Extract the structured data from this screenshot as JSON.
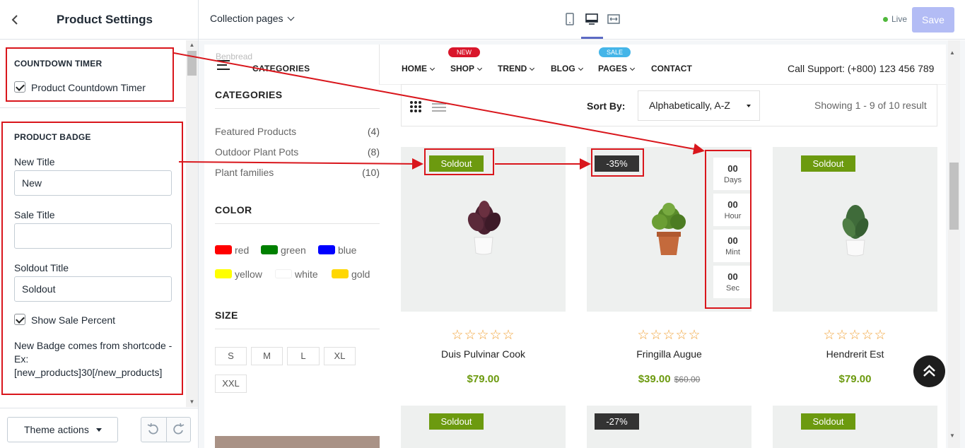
{
  "sidebar": {
    "title": "Product Settings",
    "countdown": {
      "heading": "COUNTDOWN TIMER",
      "checkbox_label": "Product Countdown Timer"
    },
    "badge": {
      "heading": "PRODUCT BADGE",
      "new_title_label": "New Title",
      "new_title_value": "New",
      "sale_title_label": "Sale Title",
      "sale_title_value": "",
      "soldout_title_label": "Soldout Title",
      "soldout_title_value": "Soldout",
      "show_sale_label": "Show Sale Percent",
      "help_text": "New Badge comes from shortcode - Ex: [new_products]30[/new_products]"
    },
    "footer": {
      "theme_actions": "Theme actions"
    }
  },
  "topbar": {
    "collection": "Collection pages",
    "live": "Live",
    "save": "Save"
  },
  "store": {
    "breadcrumb": "Benbread",
    "categories_menu": "CATEGORIES",
    "nav": [
      {
        "label": "HOME"
      },
      {
        "label": "SHOP"
      },
      {
        "label": "TREND"
      },
      {
        "label": "BLOG"
      },
      {
        "label": "PAGES"
      },
      {
        "label": "CONTACT"
      }
    ],
    "tags": {
      "new": "NEW",
      "sale": "SALE"
    },
    "support": "Call Support: (+800) 123 456 789",
    "filters": {
      "categories_title": "CATEGORIES",
      "categories": [
        {
          "name": "Featured Products",
          "count": "(4)"
        },
        {
          "name": "Outdoor Plant Pots",
          "count": "(8)"
        },
        {
          "name": "Plant families",
          "count": "(10)"
        }
      ],
      "color_title": "COLOR",
      "colors": [
        {
          "name": "red",
          "hex": "#ff0000"
        },
        {
          "name": "green",
          "hex": "#008000"
        },
        {
          "name": "blue",
          "hex": "#0000ff"
        },
        {
          "name": "yellow",
          "hex": "#ffff00"
        },
        {
          "name": "white",
          "hex": "#ffffff"
        },
        {
          "name": "gold",
          "hex": "#ffd700"
        }
      ],
      "size_title": "SIZE",
      "sizes": [
        "S",
        "M",
        "L",
        "XL",
        "XXL"
      ]
    },
    "toolbar": {
      "sort_by": "Sort By:",
      "sort_value": "Alphabetically, A-Z",
      "showing": "Showing 1 - 9 of 10 result"
    },
    "countdown": [
      {
        "num": "00",
        "label": "Days"
      },
      {
        "num": "00",
        "label": "Hour"
      },
      {
        "num": "00",
        "label": "Mint"
      },
      {
        "num": "00",
        "label": "Sec"
      }
    ],
    "products": [
      {
        "name": "Duis Pulvinar Cook",
        "price": "$79.00",
        "old_price": "",
        "badge": "Soldout",
        "rating": 0
      },
      {
        "name": "Fringilla Augue",
        "price": "$39.00",
        "old_price": "$60.00",
        "badge": "-35%",
        "rating": 0
      },
      {
        "name": "Hendrerit Est",
        "price": "$79.00",
        "old_price": "",
        "badge": "Soldout",
        "rating": 0
      }
    ],
    "row2_badges": [
      "Soldout",
      "-27%",
      "Soldout"
    ]
  }
}
